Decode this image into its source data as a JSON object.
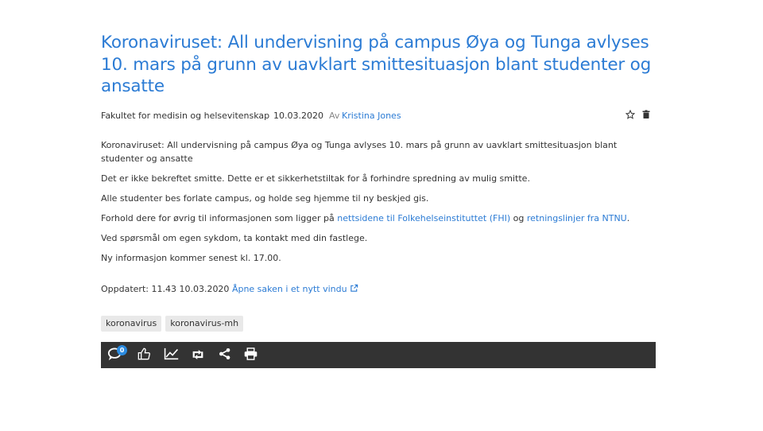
{
  "article": {
    "title": "Koronaviruset: All undervisning på campus Øya og Tunga avlyses 10. mars på grunn av uavklart smittesituasjon blant studenter og ansatte",
    "faculty": "Fakultet for medisin og helsevitenskap",
    "date": "10.03.2020",
    "by_label": "Av",
    "author": "Kristina Jones",
    "paragraphs": {
      "p1": "Koronaviruset: All undervisning på campus Øya og Tunga avlyses 10. mars på grunn av uavklart smittesituasjon blant studenter og ansatte",
      "p2": "Det er ikke bekreftet smitte. Dette er et sikkerhetstiltak for å forhindre spredning av mulig smitte.",
      "p3": "Alle studenter bes forlate campus, og holde seg hjemme til ny beskjed gis.",
      "p4_prefix": "Forhold dere for øvrig til informasjonen som ligger på ",
      "p4_link1": "nettsidene til Folkehelseinstituttet (FHI)",
      "p4_middle": " og ",
      "p4_link2": "retningslinjer fra NTNU",
      "p4_suffix": ".",
      "p5": "Ved spørsmål om egen sykdom, ta kontakt med din fastlege.",
      "p6": "Ny informasjon kommer senest kl. 17.00."
    },
    "updated_label": "Oppdatert: 11.43 10.03.2020",
    "open_link": "Åpne saken i et nytt vindu",
    "tags": [
      "koronavirus",
      "koronavirus-mh"
    ]
  },
  "toolbar": {
    "comment_count": "0",
    "icons": [
      "comment-icon",
      "thumbs-up-icon",
      "chart-icon",
      "retweet-icon",
      "share-icon",
      "print-icon"
    ],
    "bg_color": "#333333"
  },
  "colors": {
    "link": "#2b7bd4",
    "badge": "#2b8be0"
  }
}
